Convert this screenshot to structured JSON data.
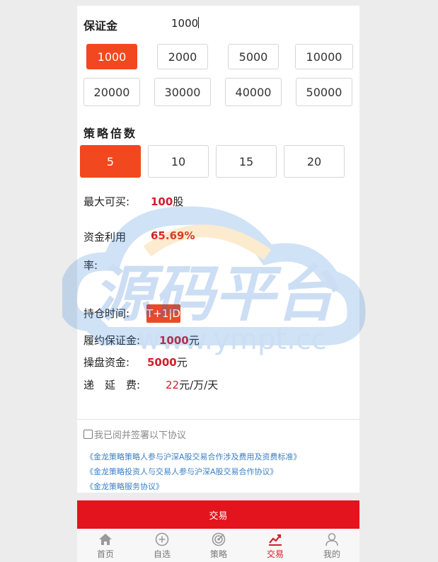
{
  "deposit": {
    "label": "保证金",
    "value": "1000",
    "options": [
      "1000",
      "2000",
      "5000",
      "10000",
      "20000",
      "30000",
      "40000",
      "50000"
    ],
    "selected": "1000"
  },
  "multiplier": {
    "label": "策略倍数",
    "options": [
      "5",
      "10",
      "15",
      "20"
    ],
    "selected": "5"
  },
  "info": {
    "max_buy_label": "最大可买:",
    "max_buy_value": "100",
    "max_buy_unit": "股",
    "utilization_label_1": "资金利用",
    "utilization_label_2": "率:",
    "utilization_value": "65.69%",
    "holding_label": "持仓时间:",
    "holding_value": "T+1|D",
    "performance_label": "履约保证金:",
    "performance_value": "1000",
    "performance_unit": "元",
    "trading_label": "操盘资金:",
    "trading_value": "5000",
    "trading_unit": "元",
    "deferral_label": "递　延　费:",
    "deferral_value": "22",
    "deferral_unit": "元/万/天"
  },
  "agreement": {
    "checkbox_label": "我已阅并签署以下协议",
    "links": [
      "《金龙策略策略人参与沪深A股交易合作涉及费用及资费标准》",
      "《金龙策略投资人与交易人参与沪深A股交易合作协议》",
      "《金龙策略服务协议》"
    ]
  },
  "trade_button": "交易",
  "tabbar": {
    "items": [
      {
        "label": "首页",
        "icon": "home-icon"
      },
      {
        "label": "自选",
        "icon": "plus-circle-icon"
      },
      {
        "label": "策略",
        "icon": "target-icon"
      },
      {
        "label": "交易",
        "icon": "trend-chart-icon"
      },
      {
        "label": "我的",
        "icon": "user-icon"
      }
    ],
    "active": "交易"
  },
  "watermark": {
    "text_cn": "源码平台",
    "text_url": "www.ympt.cc"
  },
  "colors": {
    "accent": "#f2481f",
    "trade_red": "#e3141d",
    "value_red": "#d21e28",
    "link_blue": "#3a7fc4"
  }
}
